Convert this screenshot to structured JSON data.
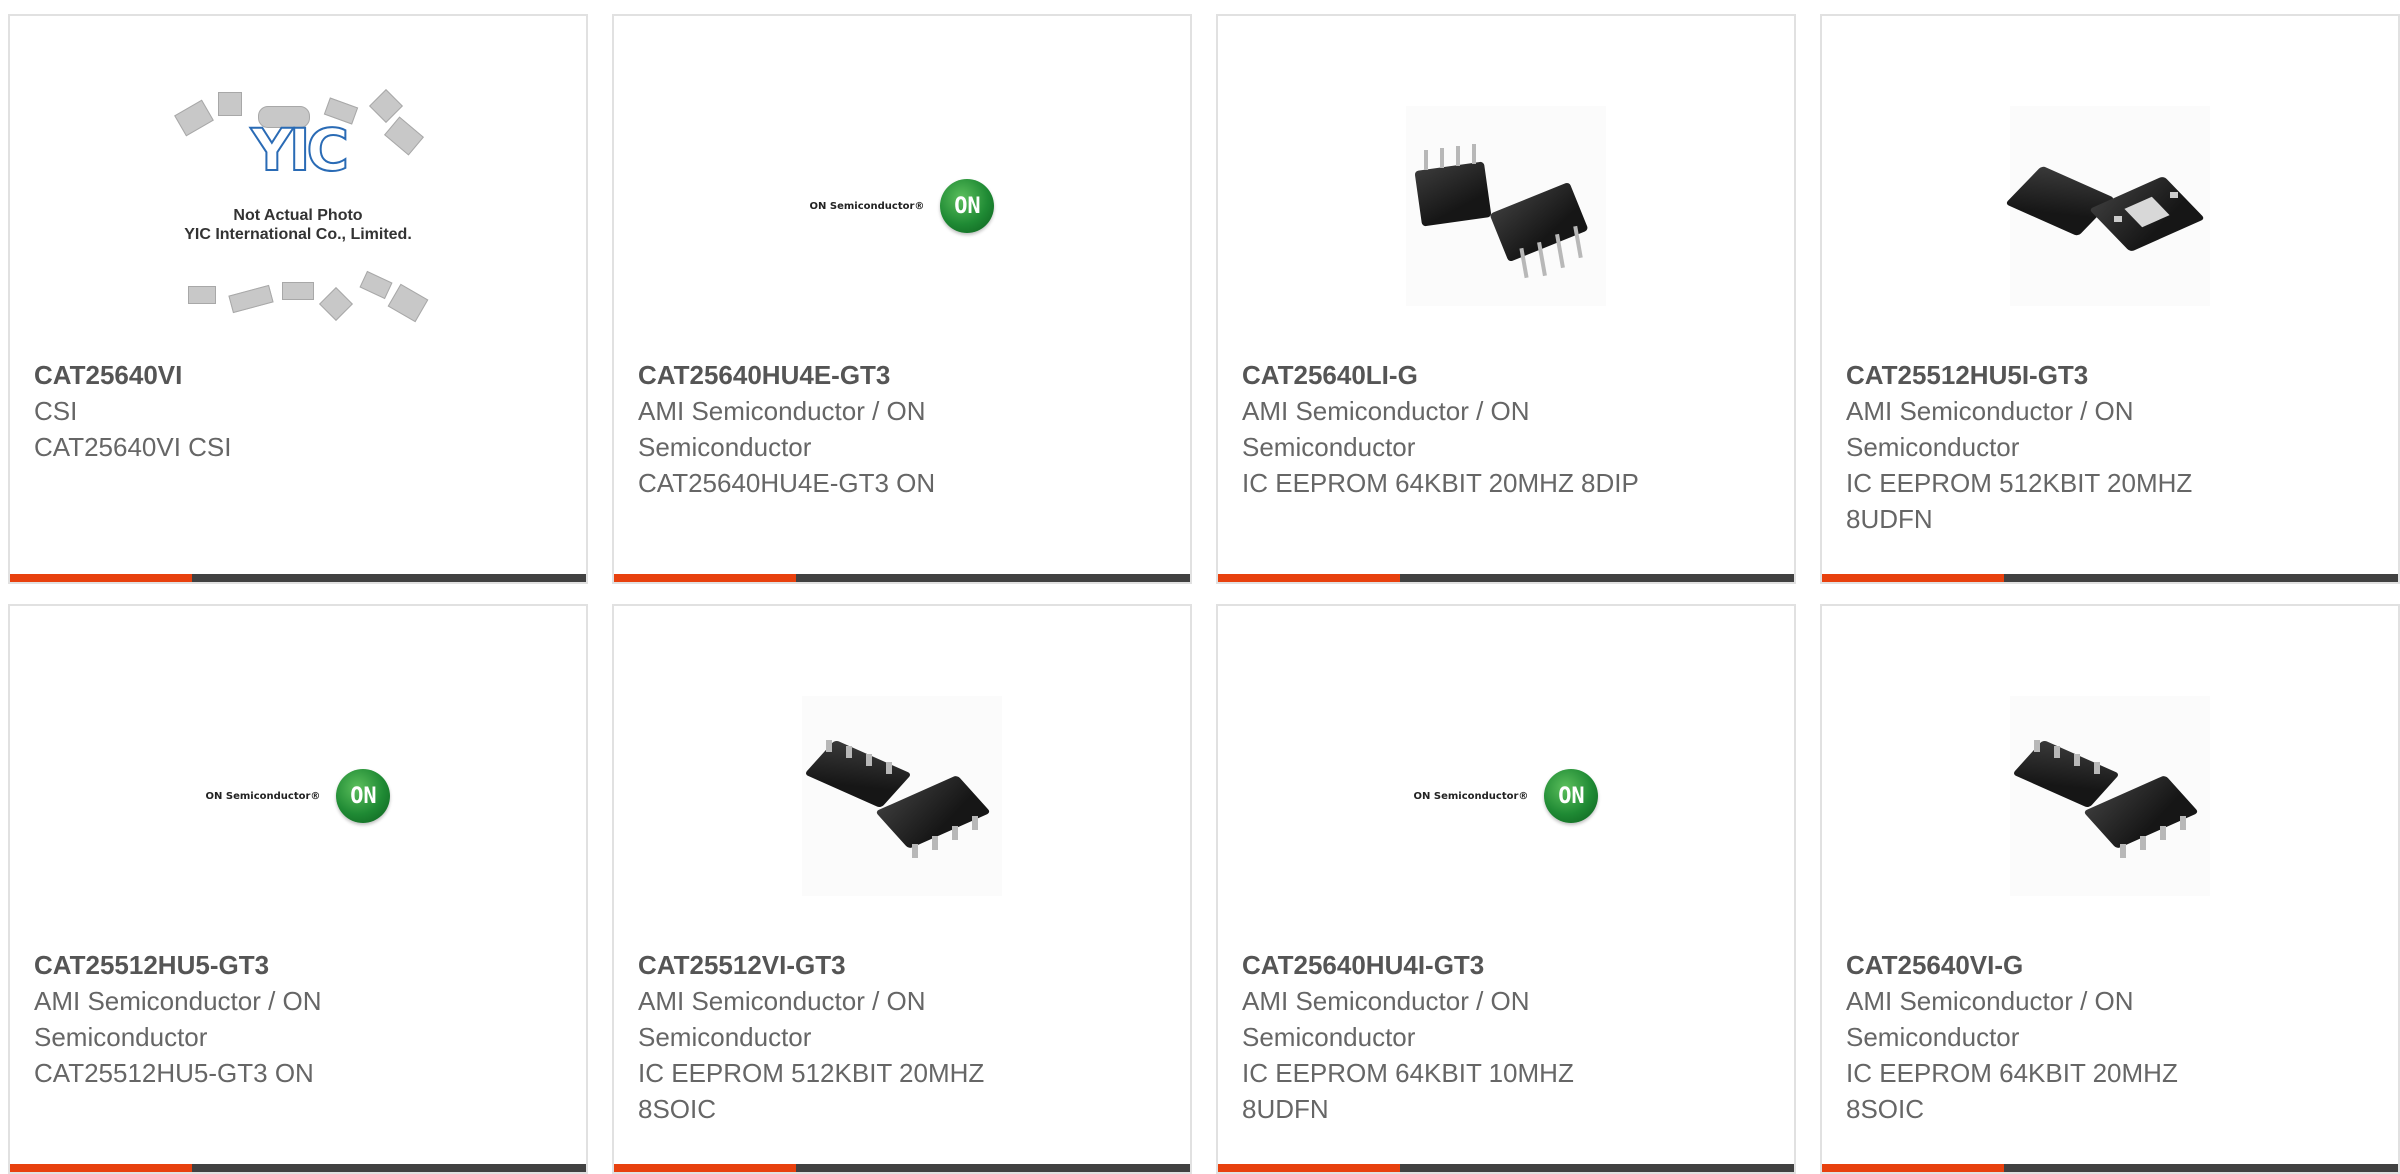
{
  "products": [
    {
      "part_number": "CAT25640VI",
      "manufacturer": "CSI",
      "description": "CAT25640VI CSI",
      "image_type": "yic-placeholder",
      "image_text": {
        "logo": "YIC",
        "line1": "Not Actual Photo",
        "line2": "YIC International Co., Limited."
      }
    },
    {
      "part_number": "CAT25640HU4E-GT3",
      "manufacturer": "AMI Semiconductor / ON Semiconductor",
      "description": "CAT25640HU4E-GT3 ON",
      "image_type": "on-logo",
      "image_text": {
        "brand": "ON Semiconductor®",
        "badge": "ON"
      }
    },
    {
      "part_number": "CAT25640LI-G",
      "manufacturer": "AMI Semiconductor / ON Semiconductor",
      "description": "IC EEPROM 64KBIT 20MHZ 8DIP",
      "image_type": "dip-photo"
    },
    {
      "part_number": "CAT25512HU5I-GT3",
      "manufacturer": "AMI Semiconductor / ON Semiconductor",
      "description": "IC EEPROM 512KBIT 20MHZ 8UDFN",
      "image_type": "udfn-photo"
    },
    {
      "part_number": "CAT25512HU5-GT3",
      "manufacturer": "AMI Semiconductor / ON Semiconductor",
      "description": "CAT25512HU5-GT3 ON",
      "image_type": "on-logo",
      "image_text": {
        "brand": "ON Semiconductor®",
        "badge": "ON"
      }
    },
    {
      "part_number": "CAT25512VI-GT3",
      "manufacturer": "AMI Semiconductor / ON Semiconductor",
      "description": "IC EEPROM 512KBIT 20MHZ 8SOIC",
      "image_type": "soic-photo"
    },
    {
      "part_number": "CAT25640HU4I-GT3",
      "manufacturer": "AMI Semiconductor / ON Semiconductor",
      "description": "IC EEPROM 64KBIT 10MHZ 8UDFN",
      "image_type": "on-logo",
      "image_text": {
        "brand": "ON Semiconductor®",
        "badge": "ON"
      }
    },
    {
      "part_number": "CAT25640VI-G",
      "manufacturer": "AMI Semiconductor / ON Semiconductor",
      "description": "IC EEPROM 64KBIT 20MHZ 8SOIC",
      "image_type": "soic-photo"
    }
  ],
  "colors": {
    "accent": "#e8410e",
    "bar": "#414141",
    "card_border": "#e1e1e1",
    "text": "#666666",
    "on_green": "#1f8a34",
    "yic_blue": "#2a6bb5"
  }
}
